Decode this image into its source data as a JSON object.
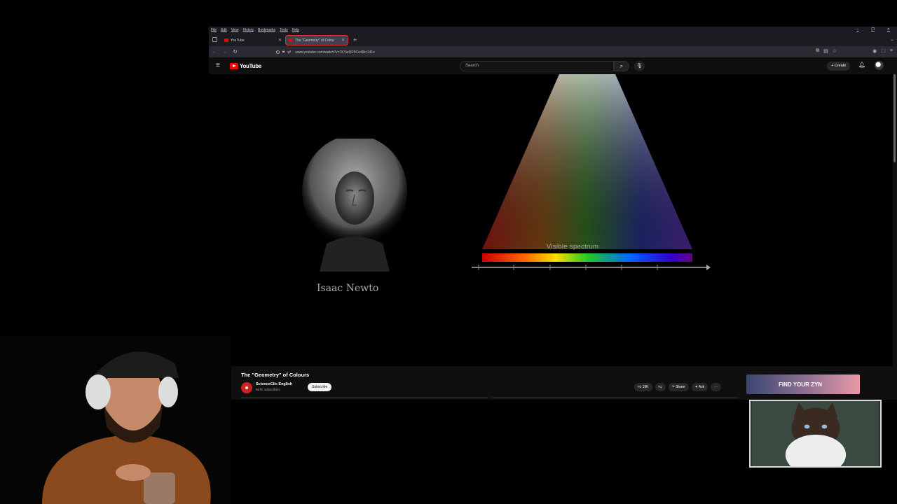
{
  "browser": {
    "menu": [
      "File",
      "Edit",
      "View",
      "History",
      "Bookmarks",
      "Tools",
      "Help"
    ],
    "tabs": [
      {
        "label": "YouTube"
      },
      {
        "label": "The \"Geometry\" of Colou"
      }
    ],
    "url": "www.youtube.com/watch?v=7KYwI3F5Ce48t=141s"
  },
  "youtube": {
    "logo_text": "YouTube",
    "search_placeholder": "Search",
    "create_label": "Create"
  },
  "video": {
    "newton_caption": "Isaac Newto",
    "spectrum_label": "Visible spectrum"
  },
  "video_info": {
    "title": "The \"Geometry\" of Colours",
    "channel": "ScienceClic English",
    "subscribers": "557K subscribers",
    "subscribe_label": "Subscribe",
    "likes": "19K",
    "share_label": "Share",
    "ask_label": "Ask"
  },
  "ad": {
    "text": "FIND YOUR ZYN"
  },
  "colors": {
    "youtube_red": "#ff0000",
    "page_bg": "#0f0f0f",
    "browser_chrome": "#1c1b22"
  }
}
